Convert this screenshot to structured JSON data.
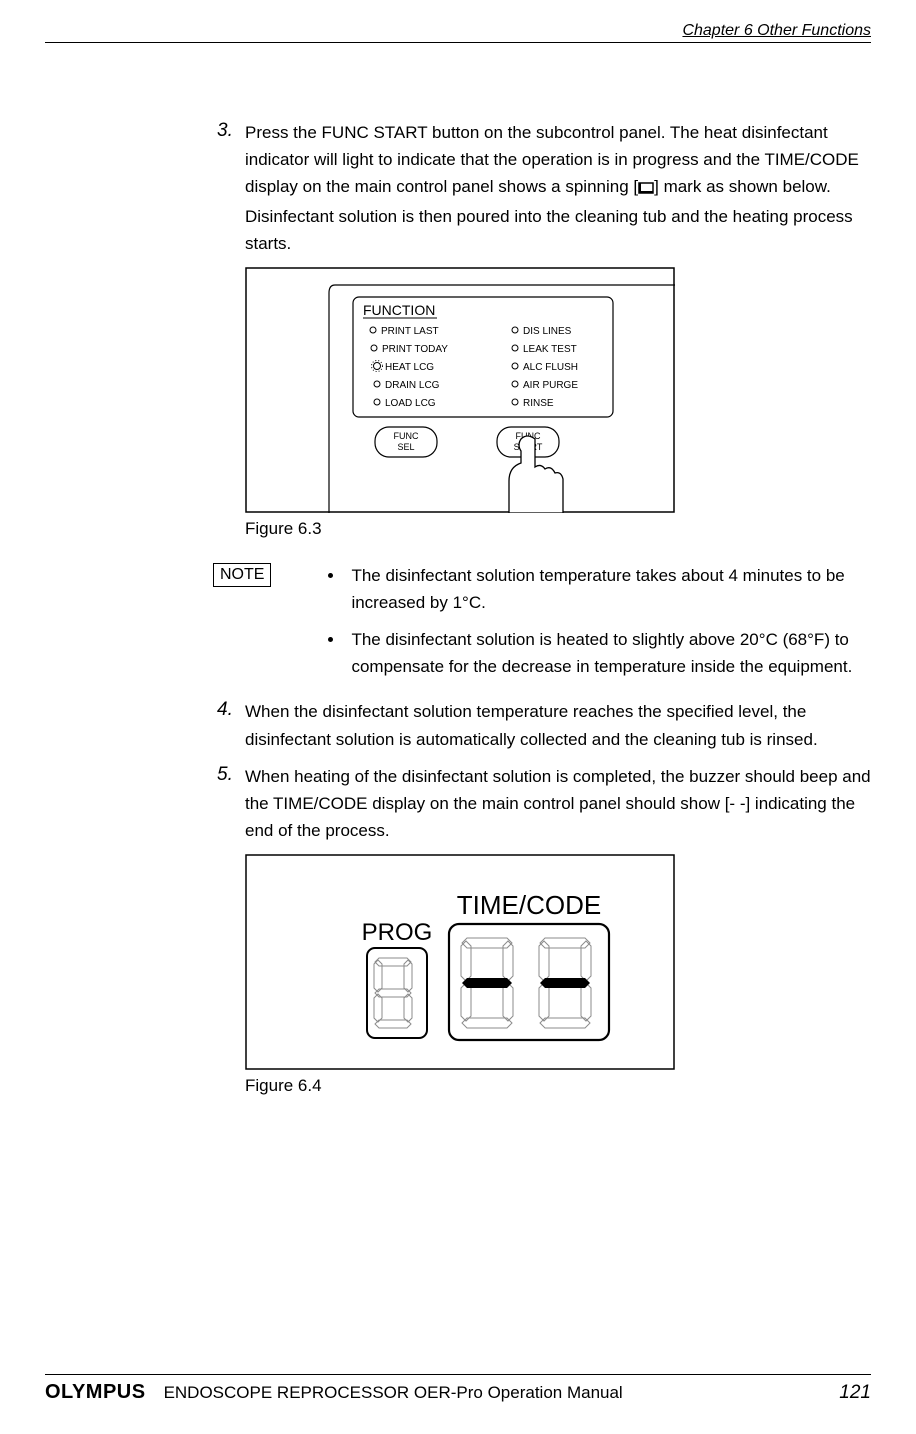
{
  "header": {
    "chapter": "Chapter 6  Other Functions"
  },
  "steps": {
    "s3_num": "3.",
    "s3_text_before": "Press the FUNC START button on the subcontrol panel. The heat disinfectant indicator will light to indicate that the operation is in progress and the TIME/CODE display on the main control panel shows a spinning [",
    "s3_text_after": "] mark as shown below. Disinfectant solution is then poured into the cleaning tub and the heating process starts.",
    "s4_num": "4.",
    "s4_text": "When the disinfectant solution temperature reaches the specified level, the disinfectant solution is automatically collected and the cleaning tub is rinsed.",
    "s5_num": "5.",
    "s5_text": "When heating of the disinfectant solution is completed, the buzzer should beep and the TIME/CODE display on the main control panel should show [- -] indicating the end of the process."
  },
  "figure63": {
    "caption": "Figure 6.3",
    "panel_title": "FUNCTION",
    "left_items": [
      "PRINT LAST",
      "PRINT TODAY",
      "HEAT LCG",
      "DRAIN LCG",
      "LOAD LCG"
    ],
    "right_items": [
      "DIS LINES",
      "LEAK TEST",
      "ALC FLUSH",
      "AIR PURGE",
      "RINSE"
    ],
    "btn_sel": "FUNC\nSEL",
    "btn_start": "FUNC\nSTART"
  },
  "note": {
    "label": "NOTE",
    "items": [
      "The disinfectant solution temperature takes about 4 minutes to be increased by 1°C.",
      "The disinfectant solution is heated to slightly above 20°C (68°F) to compensate for the decrease in temperature inside the equipment."
    ]
  },
  "figure64": {
    "caption": "Figure 6.4",
    "label_prog": "PROG",
    "label_time": "TIME/CODE"
  },
  "footer": {
    "logo": "OLYMPUS",
    "title": "ENDOSCOPE REPROCESSOR OER-Pro Operation Manual",
    "page": "121"
  }
}
